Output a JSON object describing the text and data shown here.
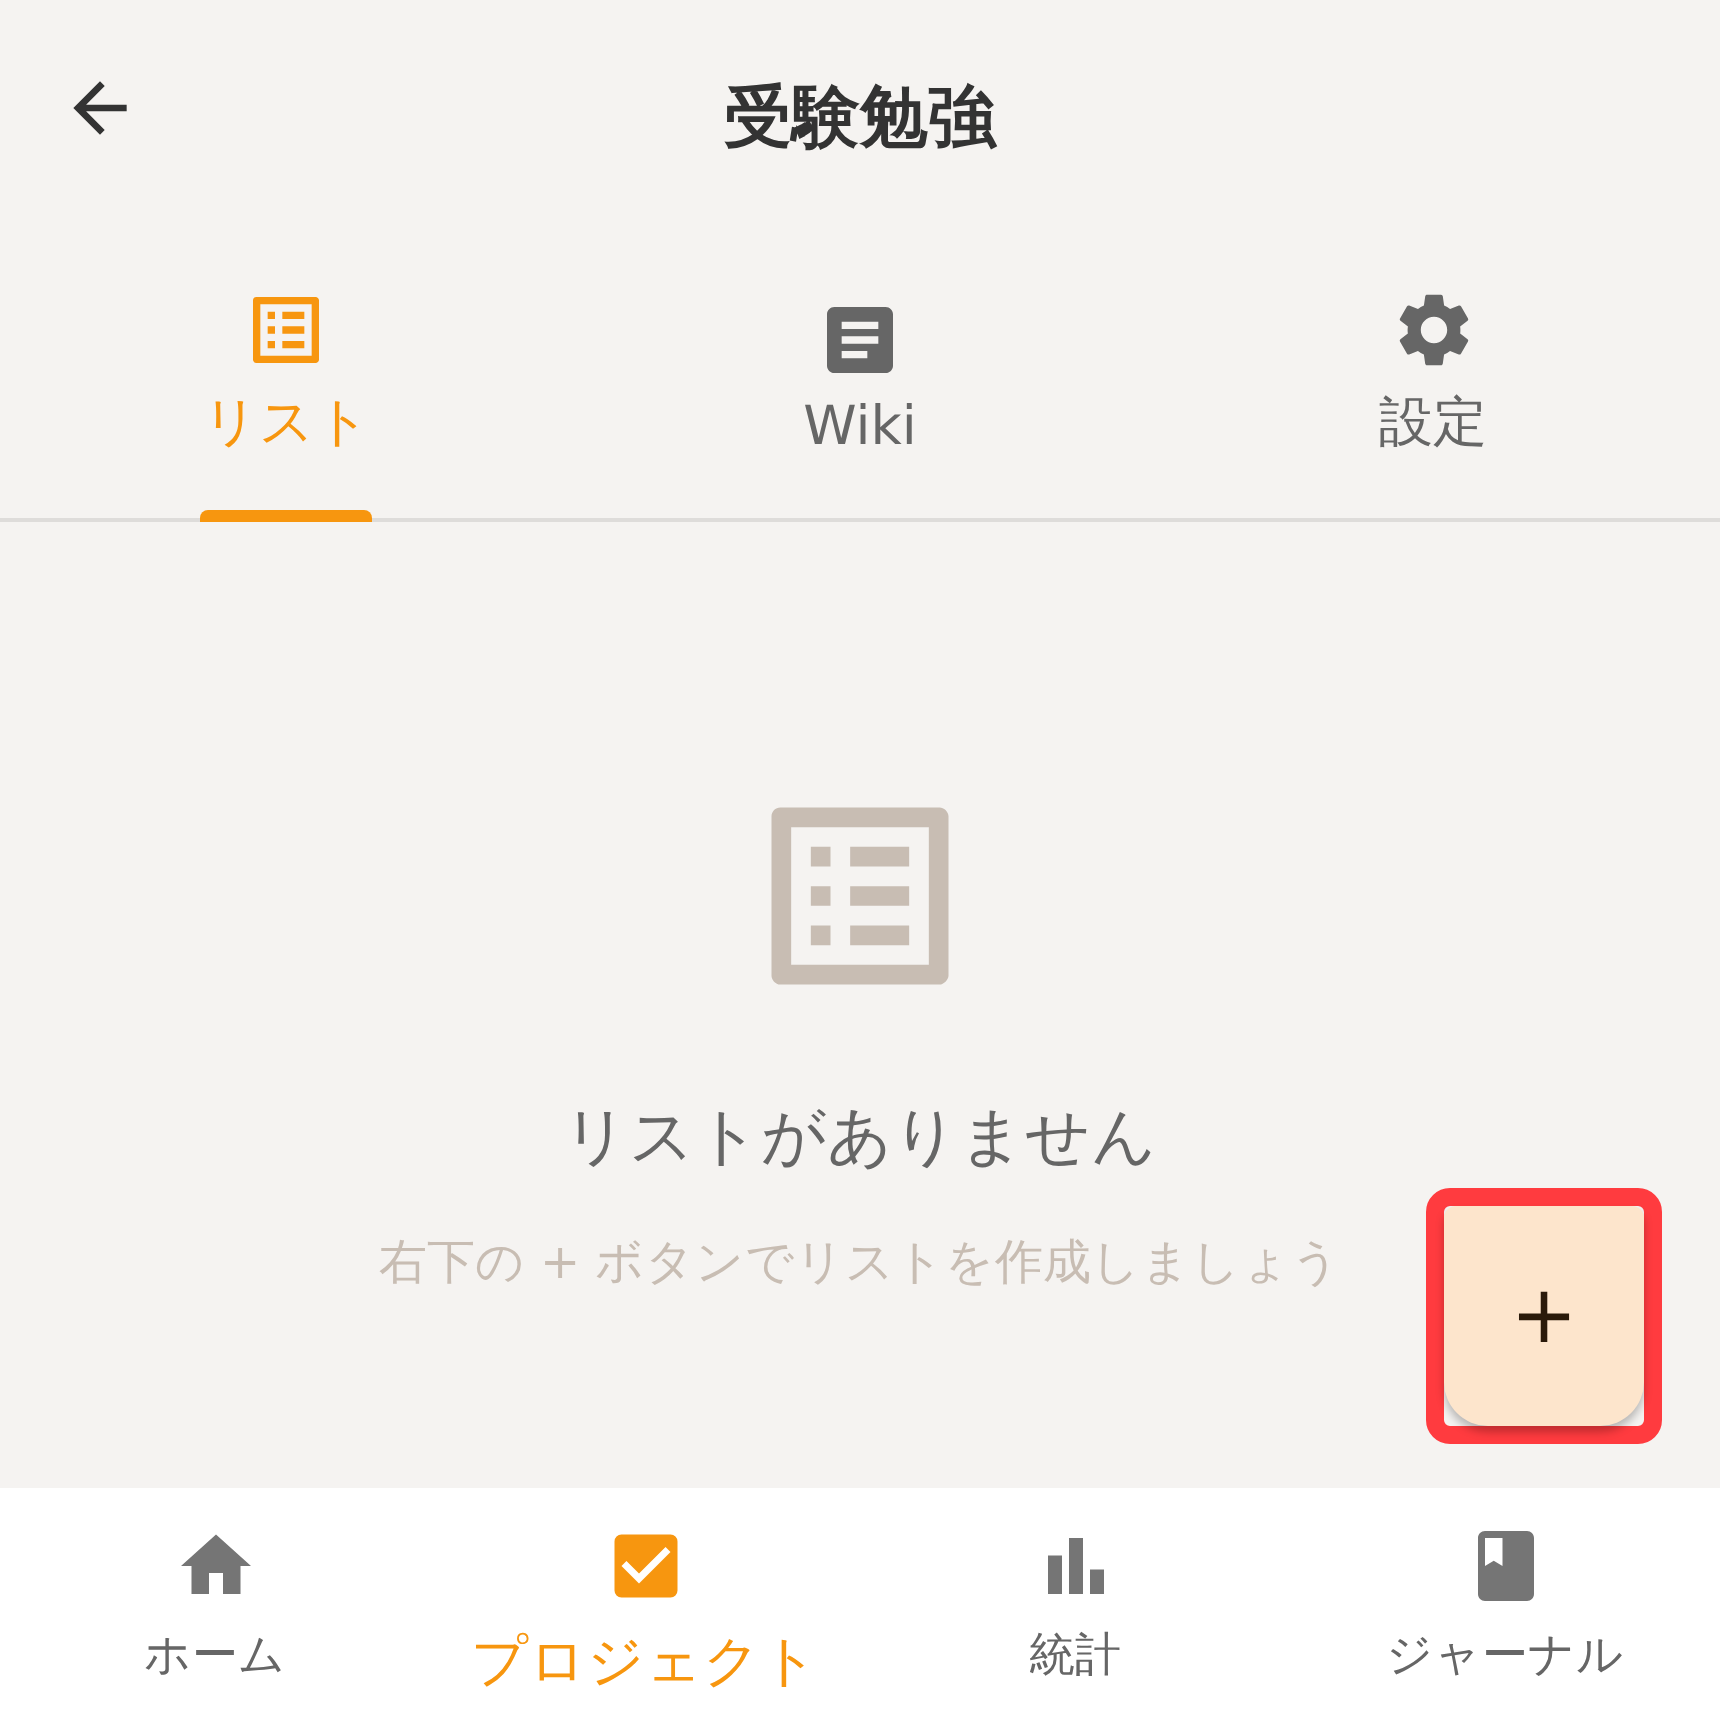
{
  "header": {
    "title": "受験勉強"
  },
  "tabs": [
    {
      "label": "リスト",
      "selected": true
    },
    {
      "label": "Wiki",
      "selected": false
    },
    {
      "label": "設定",
      "selected": false
    }
  ],
  "empty_state": {
    "title": "リストがありません",
    "hint": "右下の + ボタンでリストを作成しましょう"
  },
  "fab": {
    "label": "+",
    "highlighted": true
  },
  "bottom_nav": [
    {
      "label": "ホーム",
      "selected": false
    },
    {
      "label": "プロジェクト",
      "selected": true
    },
    {
      "label": "統計",
      "selected": false
    },
    {
      "label": "ジャーナル",
      "selected": false
    }
  ]
}
